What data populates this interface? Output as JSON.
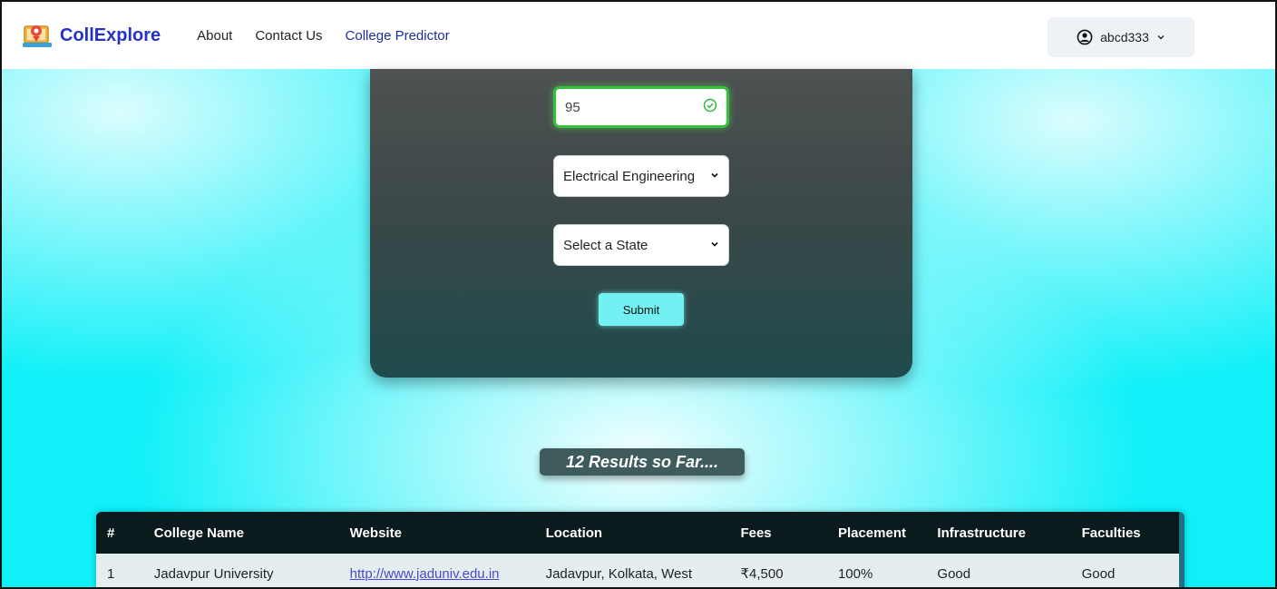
{
  "navbar": {
    "brand": "CollExplore",
    "links": [
      "About",
      "Contact Us",
      "College Predictor"
    ],
    "user": "abcd333",
    "colors": {
      "brand": "#2432c8",
      "active_link": "#1d2e9a"
    }
  },
  "form": {
    "score_value": "95",
    "branch_selected": "Electrical Engineering",
    "state_selected": "Select a State",
    "submit_label": "Submit"
  },
  "results": {
    "label": "12 Results so Far...."
  },
  "table": {
    "headers": [
      "#",
      "College Name",
      "Website",
      "Location",
      "Fees",
      "Placement",
      "Infrastructure",
      "Faculties"
    ],
    "rows": [
      [
        "1",
        "Jadavpur University",
        "http://www.jaduniv.edu.in",
        "Jadavpur, Kolkata, West",
        "₹4,500",
        "100%",
        "Good",
        "Good"
      ]
    ]
  }
}
